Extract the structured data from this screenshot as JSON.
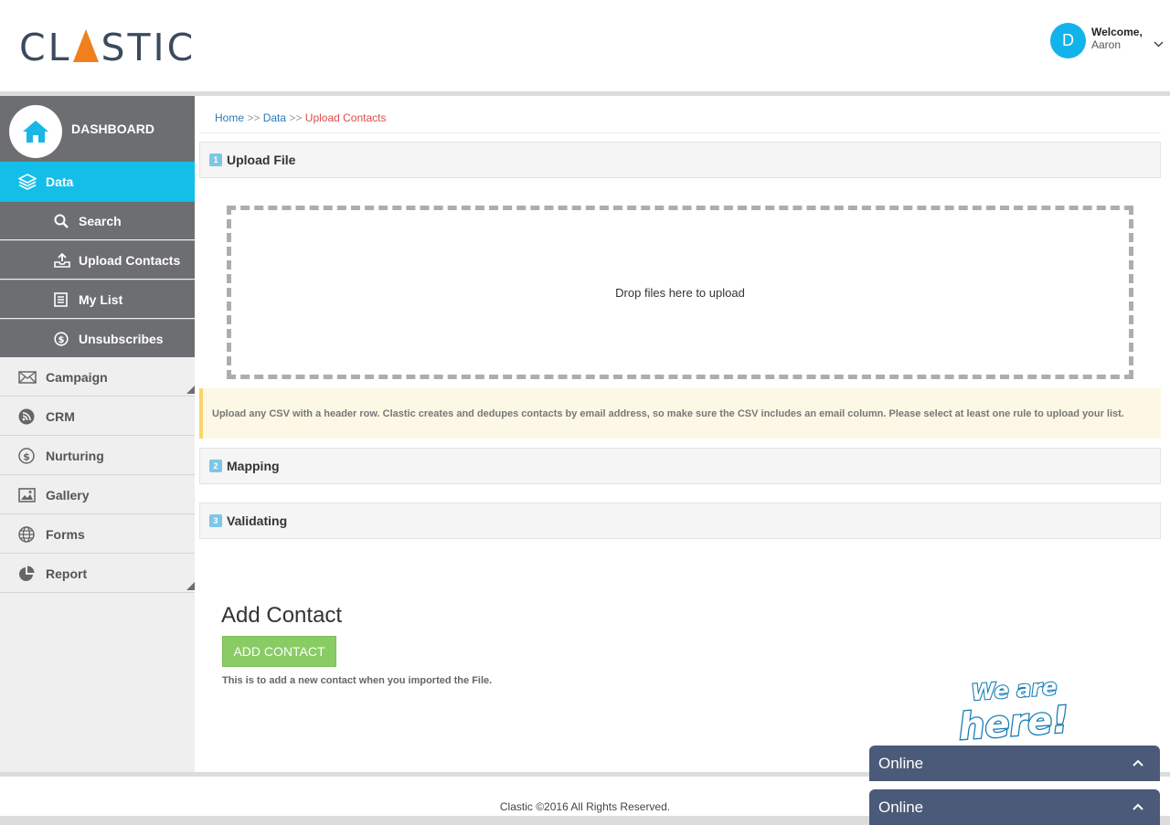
{
  "header": {
    "logo_text_left": "CL",
    "logo_text_right": "STIC",
    "avatar_letter": "D",
    "welcome": "Welcome,",
    "user_name": "Aaron"
  },
  "sidebar": {
    "dashboard": "DASHBOARD",
    "data": "Data",
    "sub_items": [
      "Search",
      "Upload Contacts",
      "My List",
      "Unsubscribes"
    ],
    "items": [
      "Campaign",
      "CRM",
      "Nurturing",
      "Gallery",
      "Forms",
      "Report"
    ]
  },
  "breadcrumb": {
    "home": "Home",
    "sep": ">>",
    "data": "Data",
    "current": "Upload Contacts"
  },
  "steps": [
    {
      "num": "1",
      "label": "Upload File"
    },
    {
      "num": "2",
      "label": "Mapping"
    },
    {
      "num": "3",
      "label": "Validating"
    }
  ],
  "dropzone": "Drop files here to upload",
  "notice": "Upload any CSV with a header row. Clastic creates and dedupes contacts by email address, so make sure the CSV includes an email column. Please select at least one rule to upload your list.",
  "add_contact": {
    "title": "Add Contact",
    "button": "ADD CONTACT",
    "hint": "This is to add a new contact when you imported the File."
  },
  "footer": "Clastic ©2016 All Rights Reserved.",
  "chat": {
    "widget_line1": "We are",
    "widget_line2": "here!",
    "status1": "Online",
    "status2": "Online"
  },
  "colors": {
    "accent": "#13bfe8",
    "sidebar_dark": "#6d6e71",
    "logo_orange": "#f07f1e",
    "button_green": "#88cc63",
    "chat_bar": "#4a5a78"
  }
}
